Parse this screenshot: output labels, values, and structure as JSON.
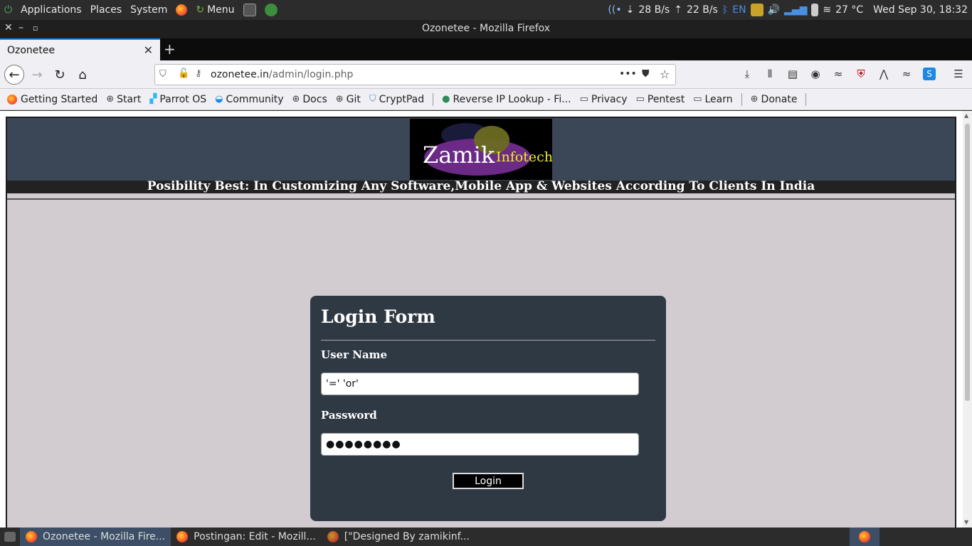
{
  "system_panel": {
    "menus": [
      "Applications",
      "Places",
      "System",
      "Menu"
    ],
    "net_down": "28 B/s",
    "net_up": "22 B/s",
    "lang": "EN",
    "temperature": "27 °C",
    "clock": "Wed Sep 30, 18:32"
  },
  "window": {
    "title": "Ozonetee - Mozilla Firefox"
  },
  "tabs": [
    {
      "label": "Ozonetee"
    }
  ],
  "urlbar": {
    "domain": "ozonetee.in",
    "path": "/admin/login.php"
  },
  "bookmarks": [
    "Getting Started",
    "Start",
    "Parrot OS",
    "Community",
    "Docs",
    "Git",
    "CryptPad",
    "Reverse IP Lookup - Fi...",
    "Privacy",
    "Pentest",
    "Learn",
    "Donate"
  ],
  "site": {
    "logo_main": "Zamik",
    "logo_sub": "Infotech",
    "tagline": "Posibility Best: In Customizing Any Software,Mobile App & Websites According To Clients In India"
  },
  "login": {
    "title": "Login Form",
    "username_label": "User Name",
    "username_value": "'=' 'or'",
    "password_label": "Password",
    "password_value": "●●●●●●●●",
    "button_label": "Login"
  },
  "taskbar": [
    {
      "label": "Ozonetee - Mozilla Fire..."
    },
    {
      "label": "Postingan: Edit - Mozill..."
    },
    {
      "label": "[\"Designed By zamikinf..."
    }
  ],
  "colors": {
    "header_bg": "#3b4756",
    "page_bg": "#d2ccd0",
    "card_bg": "#2f3944",
    "logo_sub": "#f1ec2a"
  }
}
